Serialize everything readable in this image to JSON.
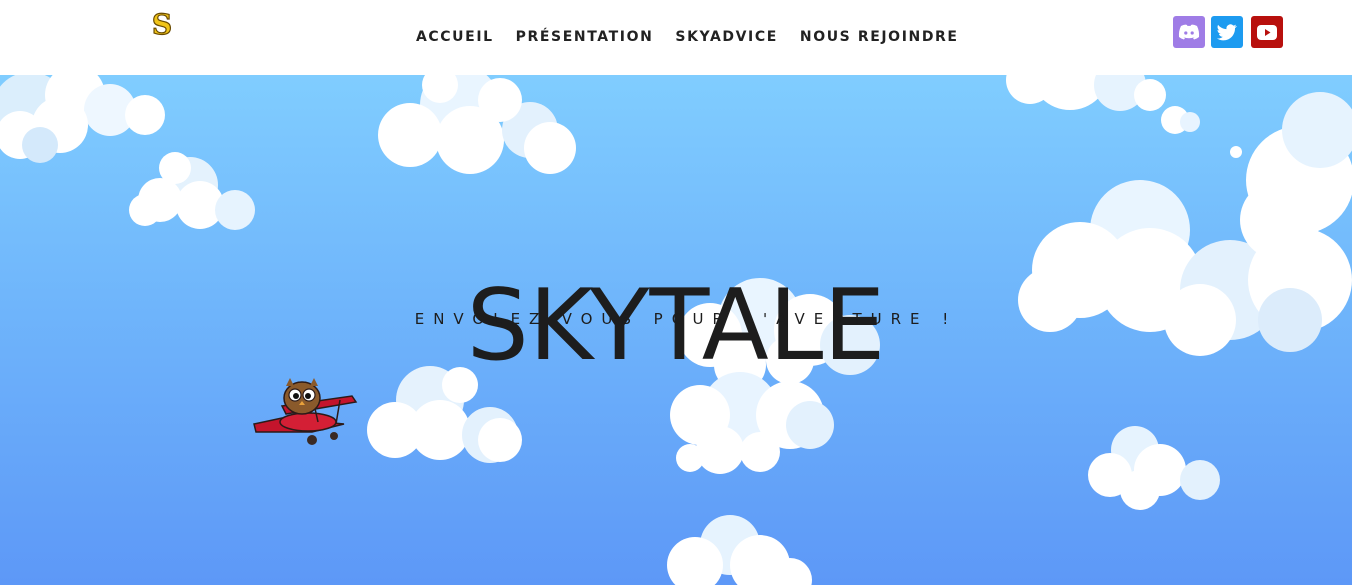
{
  "header": {
    "logo_letter": "S",
    "nav": [
      "ACCUEIL",
      "PRÉSENTATION",
      "SKYADVICE",
      "NOUS REJOINDRE"
    ],
    "social": [
      {
        "name": "discord",
        "color": "#9f7ce6"
      },
      {
        "name": "twitter",
        "color": "#1d9bf0"
      },
      {
        "name": "youtube",
        "color": "#b8100d"
      }
    ]
  },
  "hero": {
    "title": "SKYTALE",
    "subtitle": "ENVOLEZ-VOUS POUR L'AVENTURE !"
  },
  "colors": {
    "sky_top": "#80cdff",
    "sky_bottom": "#5d98f7",
    "cloud": "#ffffff",
    "cloud_shade": "#cfe6fb",
    "plane": "#c4142c"
  }
}
